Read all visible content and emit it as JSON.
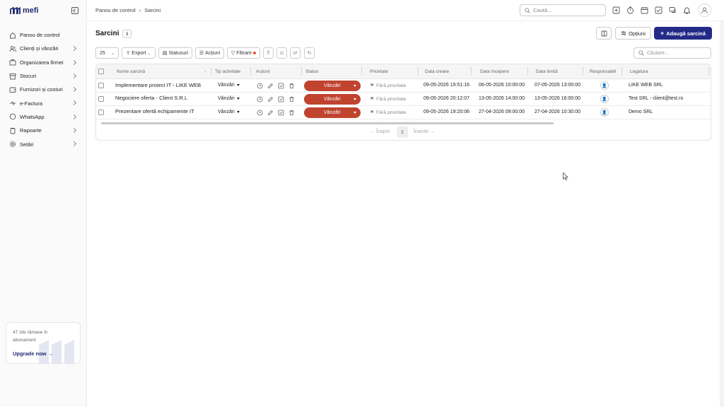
{
  "brand": {
    "name": "mefi"
  },
  "sidebar": {
    "items": [
      {
        "label": "Panou de control",
        "icon": "home-icon",
        "chevron": false
      },
      {
        "label": "Clienți și vânzări",
        "icon": "users-icon",
        "chevron": true
      },
      {
        "label": "Organizarea firmei",
        "icon": "org-icon",
        "chevron": true
      },
      {
        "label": "Stocuri",
        "icon": "box-icon",
        "chevron": true
      },
      {
        "label": "Furnizori și costuri",
        "icon": "wallet-icon",
        "chevron": true
      },
      {
        "label": "e-Factura",
        "icon": "efactura-icon",
        "chevron": true
      },
      {
        "label": "WhatsApp",
        "icon": "chat-icon",
        "chevron": true
      },
      {
        "label": "Rapoarte",
        "icon": "clipboard-icon",
        "chevron": true
      },
      {
        "label": "Setări",
        "icon": "gear-icon",
        "chevron": true
      }
    ],
    "upgrade": {
      "days_text": "47 zile rămase în abonament",
      "link": "Upgrade now"
    }
  },
  "header": {
    "breadcrumb": [
      "Panou de control",
      "Sarcini"
    ],
    "search_placeholder": "Caută..."
  },
  "page": {
    "title": "Sarcini",
    "count": "3",
    "options_label": "Opțiuni",
    "add_label": "Adaugă sarcină"
  },
  "toolbar": {
    "page_size": "25",
    "export_label": "Export",
    "statuses_label": "Statusuri",
    "actions_label": "Acțiuni",
    "filters_label": "Filtrare",
    "search_placeholder": "Căutare..."
  },
  "table": {
    "columns": [
      "Nume sarcină",
      "Tip activitate",
      "Acțiuni",
      "Status",
      "Prioritate",
      "Data creare",
      "Data începere",
      "Data limită",
      "Responsabili",
      "Legatura"
    ],
    "rows": [
      {
        "name": "Implementare proiect IT - LIKE WEB",
        "type": "Vânzări",
        "status": "Vânzări",
        "priority": "Fără prioritate",
        "created": "09-05-2026 19:51:16",
        "start": "06-05-2026 10:00:00",
        "deadline": "07-05-2026 13:00:00",
        "link": "LIKE WEB SRL"
      },
      {
        "name": "Negociere oferta - Client S.R.L",
        "type": "Vânzări",
        "status": "Vânzări",
        "priority": "Fără prioritate",
        "created": "09-05-2026 20:12:07",
        "start": "13-05-2026 14:00:00",
        "deadline": "13-05-2026 16:00:00",
        "link": "Test SRL - client@test.ro"
      },
      {
        "name": "Prezentare ofertă echipamente IT",
        "type": "Vânzări",
        "status": "Vânzări",
        "priority": "Fără prioritate",
        "created": "09-05-2026 19:20:06",
        "start": "27-04-2026 09:00:00",
        "deadline": "27-04-2026 10:30:00",
        "link": "Demo SRL"
      }
    ]
  },
  "pagination": {
    "prev": "← Înapoi",
    "page": "1",
    "next": "Înainte →"
  },
  "colors": {
    "accent": "#232b86",
    "status": "#c0432e"
  }
}
